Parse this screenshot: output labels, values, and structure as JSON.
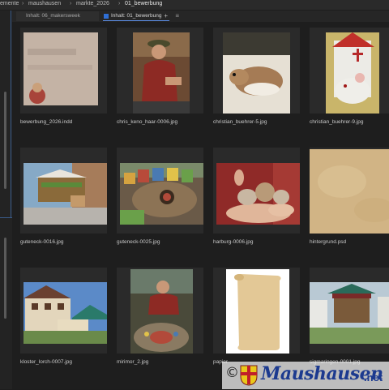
{
  "breadcrumb": {
    "segments": [
      "emente",
      "maushausen",
      "markte_2026",
      "01_bewerbung"
    ],
    "separator": "›"
  },
  "tabs": [
    {
      "label": "Inhalt: 06_makersweek",
      "active": false
    },
    {
      "label": "Inhalt: 01_bewerbung",
      "active": true
    }
  ],
  "tab_actions": {
    "add": "+",
    "menu": "≡"
  },
  "files": [
    {
      "name": "bewerbung_2026.indd",
      "icon": "blurred-document-thumbnail"
    },
    {
      "name": "chris_keno_haar-0006.jpg",
      "icon": "market-vendor-photo"
    },
    {
      "name": "christian_buehrer-5.jpg",
      "icon": "gerbil-photo"
    },
    {
      "name": "christian_buehrer-9.jpg",
      "icon": "mouse-house-photo"
    },
    {
      "name": "guteneck-0016.jpg",
      "icon": "market-stall-photo"
    },
    {
      "name": "guteneck-0025.jpg",
      "icon": "mouse-village-photo"
    },
    {
      "name": "harburg-0006.jpg",
      "icon": "mice-in-hands-photo"
    },
    {
      "name": "hintergrund.psd",
      "icon": "parchment-texture"
    },
    {
      "name": "kloster_lorch-0007.jpg",
      "icon": "half-timbered-house-photo"
    },
    {
      "name": "mirimor_2.jpg",
      "icon": "roulette-game-photo"
    },
    {
      "name": "papier",
      "icon": "paper-scroll-image"
    },
    {
      "name": "sigmaringen-0001.jpg",
      "icon": "market-tent-photo"
    }
  ],
  "watermark": {
    "copyright": "©",
    "brand": "Maushausen",
    "tld": ".net"
  },
  "colors": {
    "background": "#1e1e1e",
    "accent": "#2f6fd6",
    "brand": "#1c3a8f"
  }
}
